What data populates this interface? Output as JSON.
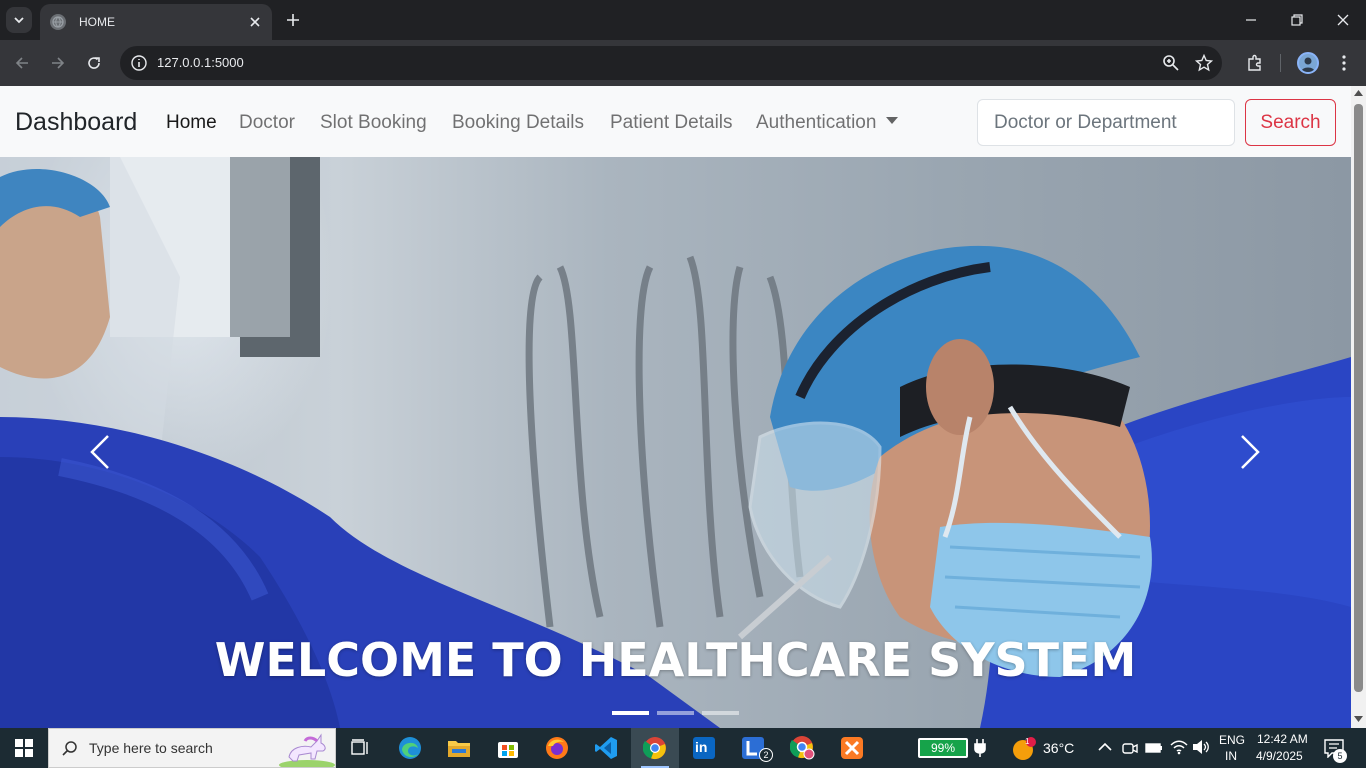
{
  "browser": {
    "tab_title": "HOME",
    "url": "127.0.0.1:5000"
  },
  "navbar": {
    "brand": "Dashboard",
    "links": [
      {
        "label": "Home",
        "active": true
      },
      {
        "label": "Doctor"
      },
      {
        "label": "Slot Booking"
      },
      {
        "label": "Booking Details"
      },
      {
        "label": "Patient Details"
      },
      {
        "label": "Authentication"
      }
    ],
    "search_placeholder": "Doctor or Department",
    "search_button": "Search"
  },
  "carousel": {
    "caption": "WELCOME TO HEALTHCARE SYSTEM",
    "slide_count": 3,
    "active_slide": 1
  },
  "taskbar": {
    "search_placeholder": "Type here to search",
    "battery": "99%",
    "temperature": "36°C",
    "language": "ENG",
    "region": "IN",
    "time": "12:42 AM",
    "date": "4/9/2025",
    "notification_count": "5",
    "linkedin_label": "in",
    "l_app_badge": "2",
    "weather_badge": "1"
  },
  "colors": {
    "danger": "#dc3545",
    "scrub_blue": "#2b49c8",
    "taskbar": "#1c2b33"
  }
}
